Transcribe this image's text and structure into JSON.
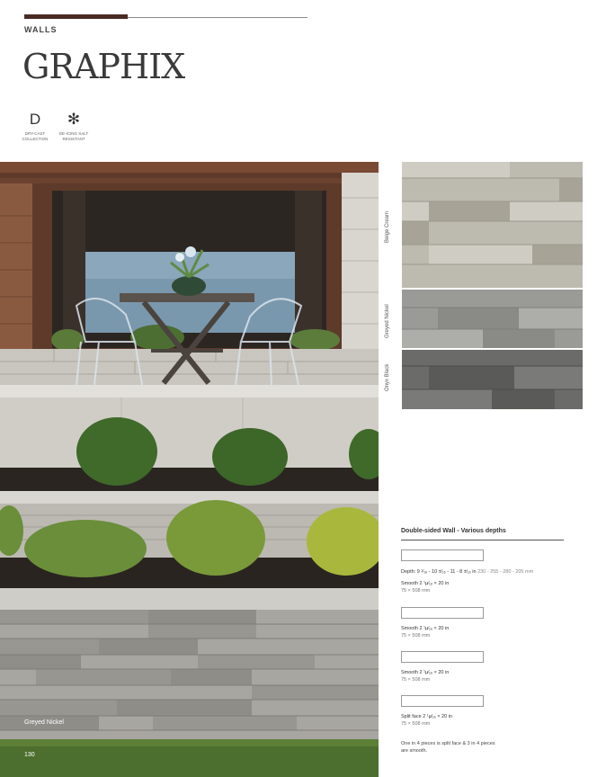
{
  "header": {
    "section": "WALLS",
    "title": "GRAPHIX"
  },
  "features": [
    {
      "icon": "dry-cast-icon",
      "glyph": "D",
      "label_line1": "DRY-CAST",
      "label_line2": "COLLECTION"
    },
    {
      "icon": "snowflake-icon",
      "glyph": "✻",
      "label_line1": "DE-ICING SALT",
      "label_line2": "RESISTANT"
    }
  ],
  "photo": {
    "caption": "Greyed Nickel",
    "page_number": "130"
  },
  "swatches": [
    {
      "name": "Beige Cream",
      "color": "#bdbab0"
    },
    {
      "name": "Greyed Nickel",
      "color": "#9a9a96"
    },
    {
      "name": "Onyx Black",
      "color": "#6b6b69"
    }
  ],
  "spec": {
    "title": "Double-sided Wall - Various depths",
    "depth_label": "Depth: 9 ¹⁄₁₆ - 10 ±⁄₁₆ - 11 - 8 ±⁄₁₆ in",
    "depth_mm": "230 - 255 - 280 - 205 mm",
    "items": [
      {
        "dim": "Smooth 2 ¹µ⁄₁₆ × 20 in",
        "mm": "75 × 508 mm"
      },
      {
        "dim": "Smooth 2 ¹µ⁄₁₆ × 20 in",
        "mm": "75 × 508 mm"
      },
      {
        "dim": "Smooth 2 ¹µ⁄₁₆ × 20 in",
        "mm": "75 × 508 mm"
      },
      {
        "dim": "Split face 2 ¹µ⁄₁₆ × 20 in",
        "mm": "75 × 508 mm"
      }
    ],
    "note": "One in 4 pieces is split face & 3 in 4 pieces are smooth."
  },
  "colors": {
    "accent": "#4a2a24"
  }
}
